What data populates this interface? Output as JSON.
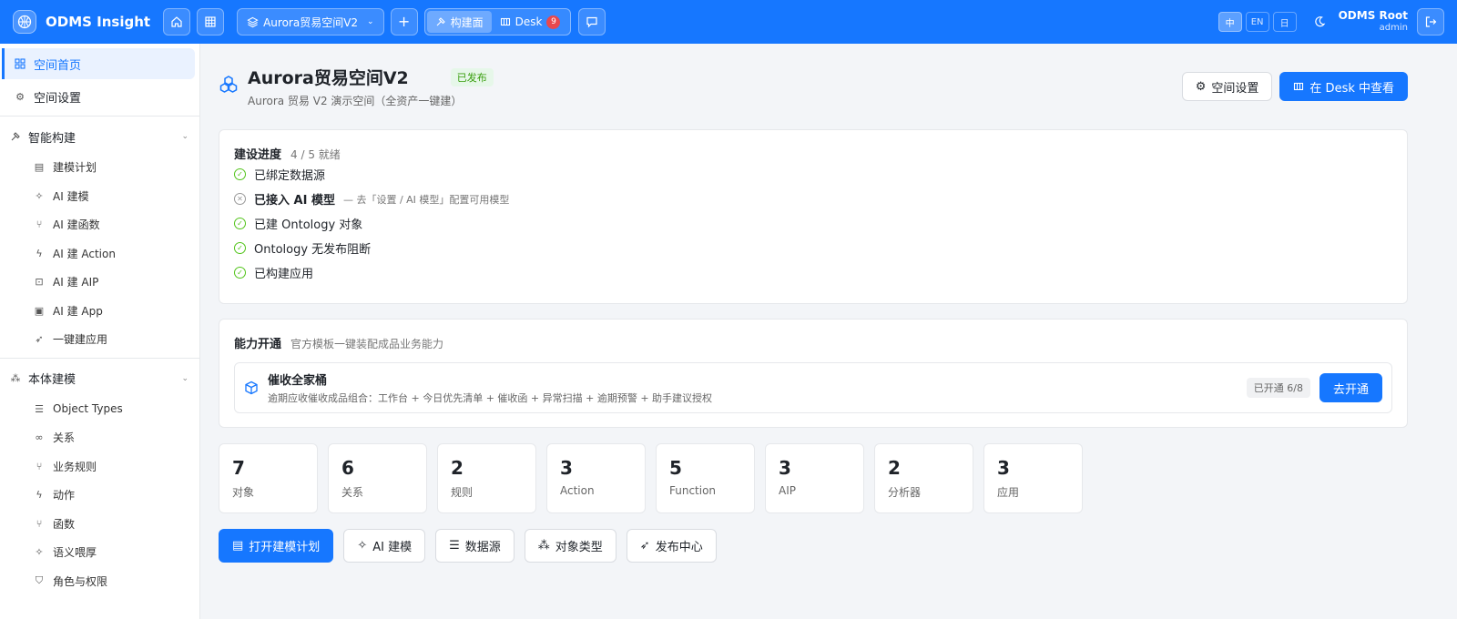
{
  "topbar": {
    "brand": "ODMS Insight",
    "space_name": "Aurora贸易空间V2",
    "modes": {
      "build": "构建面",
      "desk": "Desk",
      "desk_badge": "9"
    },
    "langs": [
      "中",
      "EN",
      "日"
    ],
    "user": {
      "name": "ODMS Root",
      "role": "admin"
    }
  },
  "sidebar": {
    "home": "空间首页",
    "settings": "空间设置",
    "group_build": "智能构建",
    "build_items": [
      "建模计划",
      "AI 建模",
      "AI 建函数",
      "AI 建 Action",
      "AI 建 AIP",
      "AI 建 App",
      "一键建应用"
    ],
    "group_ontology": "本体建模",
    "ontology_items": [
      "Object Types",
      "关系",
      "业务规则",
      "动作",
      "函数",
      "语义喂厚",
      "角色与权限"
    ]
  },
  "header": {
    "title": "Aurora贸易空间V2",
    "status": "已发布",
    "subtitle": "Aurora 贸易 V2 演示空间（全资产一键建）",
    "settings_btn": "空间设置",
    "desk_btn": "在 Desk 中查看"
  },
  "progress": {
    "title": "建设进度",
    "summary": "4 / 5 就绪",
    "items": [
      {
        "label": "已绑定数据源",
        "done": true,
        "hint": ""
      },
      {
        "label": "已接入 AI 模型",
        "done": false,
        "hint": "— 去「设置 / AI 模型」配置可用模型"
      },
      {
        "label": "已建 Ontology 对象",
        "done": true,
        "hint": ""
      },
      {
        "label": "Ontology 无发布阻断",
        "done": true,
        "hint": ""
      },
      {
        "label": "已构建应用",
        "done": true,
        "hint": ""
      }
    ]
  },
  "capability": {
    "title": "能力开通",
    "subtitle": "官方模板一键装配成品业务能力",
    "item": {
      "name": "催收全家桶",
      "desc": "逾期应收催收成品组合：工作台 + 今日优先清单 + 催收函 + 异常扫描 + 逾期预警 + 助手建议授权",
      "status": "已开通 6/8",
      "action": "去开通"
    }
  },
  "stats": [
    {
      "value": "7",
      "label": "对象"
    },
    {
      "value": "6",
      "label": "关系"
    },
    {
      "value": "2",
      "label": "规则"
    },
    {
      "value": "3",
      "label": "Action"
    },
    {
      "value": "5",
      "label": "Function"
    },
    {
      "value": "3",
      "label": "AIP"
    },
    {
      "value": "2",
      "label": "分析器"
    },
    {
      "value": "3",
      "label": "应用"
    }
  ],
  "actions": [
    "打开建模计划",
    "AI 建模",
    "数据源",
    "对象类型",
    "发布中心"
  ],
  "colors": {
    "primary": "#1677ff",
    "success": "#52c41a",
    "danger": "#e8484e"
  }
}
